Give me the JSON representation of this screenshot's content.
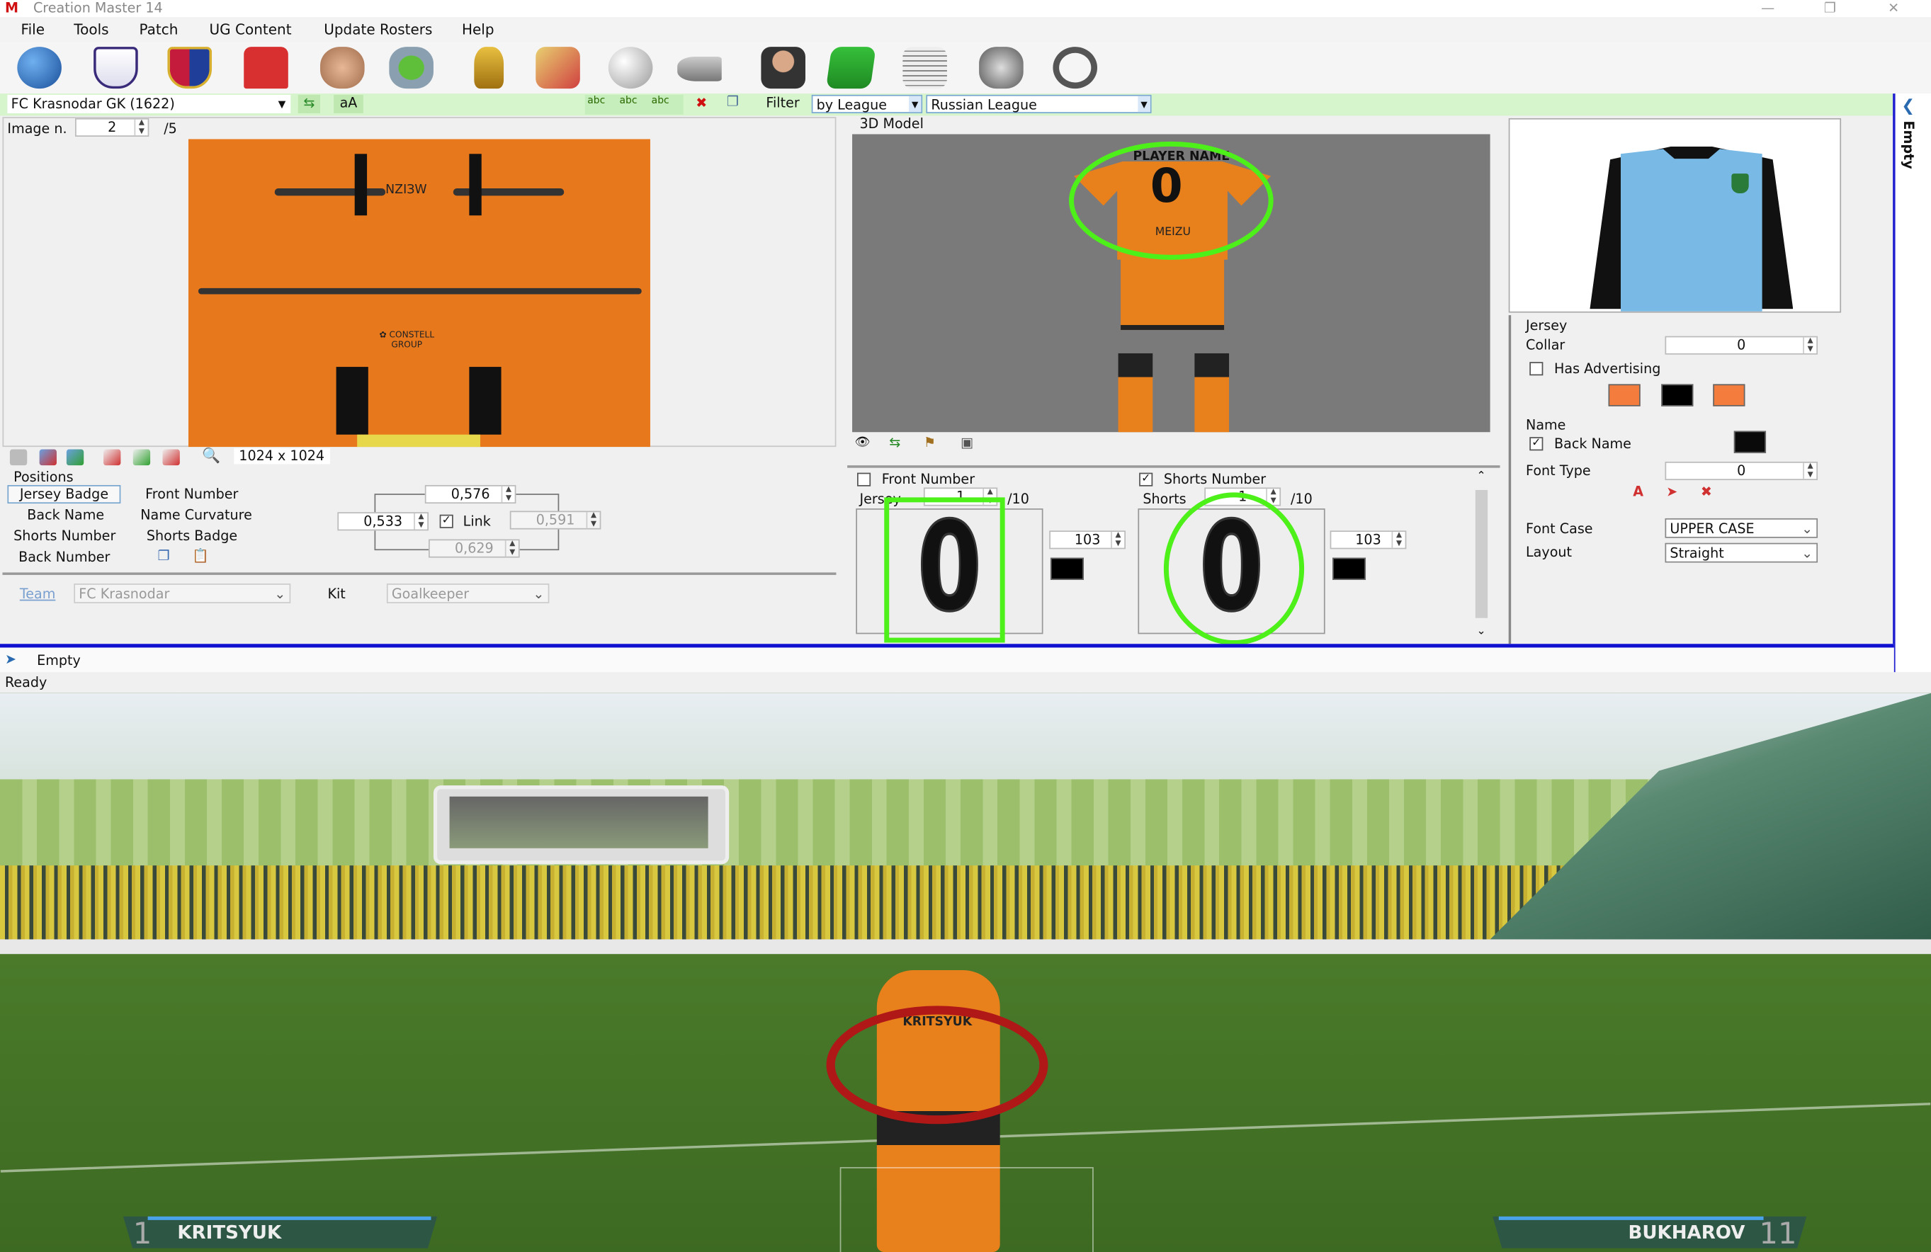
{
  "window": {
    "title": "Creation Master 14",
    "app_logo": "CM",
    "controls": [
      "minimize-icon",
      "restore-icon",
      "close-icon"
    ]
  },
  "menu": [
    "File",
    "Tools",
    "Patch",
    "UG Content",
    "Update Rosters",
    "Help"
  ],
  "toolbar_icons": [
    "globe-icon",
    "premier-league-icon",
    "club-crest-icon",
    "kit-icon",
    "player-face-icon",
    "stadium-icon",
    "trophy-icon",
    "referee-cards-icon",
    "ball-icon",
    "boots-icon",
    "manager-icon",
    "pitch-icon",
    "newspaper-icon",
    "gloves-icon",
    "headphones-icon"
  ],
  "selector": {
    "item": "FC Krasnodar GK (1622)",
    "case_label": "aA",
    "filter_label": "Filter",
    "filter_by": "by League",
    "league": "Russian League"
  },
  "texture": {
    "image_label": "Image n.",
    "image_value": "2",
    "image_total": "/5",
    "size": "1024 x 1024",
    "colors": {
      "jersey": "#e8781c",
      "accent": "#1a1a1a",
      "trim": "#e6d84a"
    }
  },
  "positions": {
    "label": "Positions",
    "buttons": [
      "Jersey Badge",
      "Front Number",
      "Back Name",
      "Name Curvature",
      "Shorts Number",
      "Shorts Badge",
      "Back Number"
    ],
    "selected": "Jersey Badge",
    "top": "0,576",
    "left": "0,533",
    "link_label": "Link",
    "link_checked": true,
    "right": "0,591",
    "bottom": "0,629"
  },
  "team": {
    "team_label": "Team",
    "team_value": "FC Krasnodar",
    "kit_label": "Kit",
    "kit_value": "Goalkeeper"
  },
  "model": {
    "label": "3D Model",
    "player_name": "PLAYER NAME",
    "sponsor": "MEIZU",
    "number": "0"
  },
  "numbers": {
    "front": {
      "label": "Front Number",
      "checked": false,
      "sub_label": "Jersey",
      "value": "1",
      "total": "/10",
      "size": "103",
      "color": "#000000",
      "preview": "0"
    },
    "shorts": {
      "label": "Shorts Number",
      "checked": true,
      "sub_label": "Shorts",
      "value": "1",
      "total": "/10",
      "size": "103",
      "color": "#000000",
      "preview": "0"
    }
  },
  "kit_props": {
    "jersey_label": "Jersey",
    "collar_label": "Collar",
    "collar_value": "0",
    "has_advertising_label": "Has Advertising",
    "has_advertising": false,
    "colors": [
      "#f47c3c",
      "#000000",
      "#f47c3c"
    ],
    "name_label": "Name",
    "back_name_label": "Back Name",
    "back_name": true,
    "name_color": "#0a0a0a",
    "font_type_label": "Font Type",
    "font_type_value": "0",
    "font_case_label": "Font Case",
    "font_case_value": "UPPER CASE",
    "layout_label": "Layout",
    "layout_value": "Straight",
    "preview_colors": {
      "body": "#79b9e6",
      "sleeves": "#111111"
    }
  },
  "side_panel": {
    "label": "Empty"
  },
  "bottom_panel": {
    "label": "Empty"
  },
  "status": "Ready",
  "game": {
    "shirt_name": "KRITSYUK",
    "left_player": {
      "number": "1",
      "name": "KRITSYUK"
    },
    "right_player": {
      "number": "11",
      "name": "BUKHAROV"
    }
  }
}
